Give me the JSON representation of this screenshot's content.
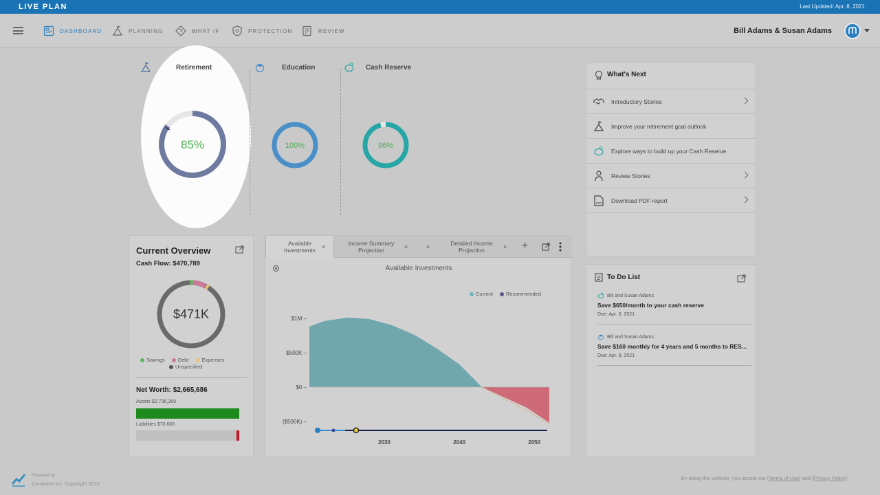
{
  "header": {
    "app_title": "LIVE PLAN",
    "last_updated": "Last Updated: Apr. 8, 2021"
  },
  "nav": {
    "items": [
      {
        "label": "DASHBOARD",
        "icon": "dashboard-icon",
        "active": true
      },
      {
        "label": "PLANNING",
        "icon": "planning-icon",
        "active": false
      },
      {
        "label": "WHAT IF",
        "icon": "what-if-icon",
        "active": false
      },
      {
        "label": "PROTECTION",
        "icon": "shield-icon",
        "active": false
      },
      {
        "label": "REVIEW",
        "icon": "review-icon",
        "active": false
      }
    ],
    "user_name": "Bill Adams & Susan Adams"
  },
  "goals": [
    {
      "name": "Retirement",
      "percent_label": "85%",
      "progress": 0.85,
      "color": "#6f7aa0",
      "text_color": "#4caf50",
      "icon": "mountain-flag-icon"
    },
    {
      "name": "Education",
      "percent_label": "100%",
      "progress": 1.0,
      "color": "#4a8fc8",
      "text_color": "#4caf50",
      "icon": "graduation-icon"
    },
    {
      "name": "Cash Reserve",
      "percent_label": "96%",
      "progress": 0.96,
      "color": "#27a6a6",
      "text_color": "#4caf50",
      "icon": "piggy-bank-icon"
    }
  ],
  "overview": {
    "title": "Current Overview",
    "cash_flow": "Cash Flow: $470,789",
    "donut_value": "$471K",
    "legend": [
      {
        "label": "Savings",
        "color": "#5cb85c"
      },
      {
        "label": "Debt",
        "color": "#c97a99"
      },
      {
        "label": "Expenses",
        "color": "#e8c27a"
      },
      {
        "label": "Unspecified",
        "color": "#555555"
      }
    ],
    "net_worth": "Net Worth: $2,665,686",
    "assets_label": "Assets $2,736,369",
    "liabilities_label": "Liabilities $70,683",
    "assets_bar_color": "#1e8a1e",
    "liabilities_bar_color": "#cc1122"
  },
  "investments": {
    "tabs": [
      {
        "label_line1": "Available",
        "label_line2": "Investments",
        "active": true
      },
      {
        "label_line1": "Income Summary",
        "label_line2": "Projection",
        "active": false
      },
      {
        "label_line1": "Detailed Income",
        "label_line2": "Projection",
        "active": false
      }
    ],
    "close_glyph": "×",
    "add_glyph": "+"
  },
  "chart_data": {
    "type": "area",
    "title": "Available Investments",
    "legend": [
      "Current",
      "Recommended"
    ],
    "legend_colors": [
      "#6fb4b8",
      "#5a5a8a"
    ],
    "x_ticks": [
      "2030",
      "2040",
      "2050"
    ],
    "y_ticks": [
      "$1M",
      "$500K",
      "$0",
      "($500K)"
    ],
    "y_tick_values": [
      1000000,
      500000,
      0,
      -500000
    ],
    "ylim": [
      -500000,
      1100000
    ],
    "xlim": [
      2020,
      2052
    ],
    "series": [
      {
        "name": "Current",
        "color": "#6fa7ad",
        "negative_color": "#cf6b78",
        "x": [
          2020,
          2022,
          2025,
          2028,
          2031,
          2034,
          2037,
          2040,
          2043,
          2046,
          2049,
          2052
        ],
        "values": [
          880000,
          960000,
          1010000,
          990000,
          900000,
          760000,
          560000,
          330000,
          0,
          -150000,
          -300000,
          -520000
        ]
      },
      {
        "name": "Recommended",
        "color": "#d8b088",
        "x": [
          2043,
          2046,
          2049,
          2052
        ],
        "values": [
          0,
          -170000,
          -340000,
          -540000
        ]
      }
    ]
  },
  "whats_next": {
    "title": "What's Next",
    "items": [
      {
        "label": "Introductory Stories",
        "icon": "handshake-icon",
        "has_chevron": true
      },
      {
        "label": "Improve your retirement goal outlook",
        "icon": "mountain-flag-icon",
        "has_chevron": false
      },
      {
        "label": "Explore ways to build up your Cash Reserve",
        "icon": "piggy-bank-icon",
        "has_chevron": false
      },
      {
        "label": "Review Stories",
        "icon": "person-icon",
        "has_chevron": true
      },
      {
        "label": "Download PDF report",
        "icon": "pdf-icon",
        "has_chevron": true
      }
    ]
  },
  "todo": {
    "title": "To Do List",
    "items": [
      {
        "who": "Bill and Susan Adams",
        "task": "Save $650/month to your cash reserve",
        "due": "Due: Apr. 8, 2021",
        "icon": "piggy-bank-icon"
      },
      {
        "who": "Bill and Susan Adams",
        "task": "Save $160 monthly for 4 years and 5 months to RES...",
        "due": "Due: Apr. 8, 2021",
        "icon": "graduation-icon"
      }
    ]
  },
  "footer": {
    "powered_by": "Powered by",
    "copyright": "Conquest Inc. Copyright 2021",
    "terms_prefix": "By using this website, you accept our ",
    "terms_link": "[Terms of Use]",
    "terms_and": " and ",
    "privacy_link": "[Privacy Policy]",
    "terms_suffix": "."
  }
}
